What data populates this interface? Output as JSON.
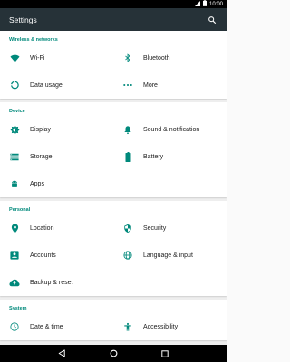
{
  "status_bar": {
    "time": "10:00",
    "signal_icon": "signal-icon",
    "battery_icon": "battery-icon"
  },
  "app_bar": {
    "title": "Settings",
    "search_icon": "search-icon"
  },
  "sections": {
    "wireless": {
      "header": "Wireless & networks",
      "items": [
        {
          "label": "Wi-Fi",
          "icon": "wifi-icon"
        },
        {
          "label": "Bluetooth",
          "icon": "bluetooth-icon"
        },
        {
          "label": "Data usage",
          "icon": "data-usage-icon"
        },
        {
          "label": "More",
          "icon": "more-icon"
        }
      ]
    },
    "device": {
      "header": "Device",
      "items": [
        {
          "label": "Display",
          "icon": "brightness-icon"
        },
        {
          "label": "Sound & notification",
          "icon": "bell-icon"
        },
        {
          "label": "Storage",
          "icon": "storage-icon"
        },
        {
          "label": "Battery",
          "icon": "battery-icon"
        },
        {
          "label": "Apps",
          "icon": "android-icon"
        }
      ]
    },
    "personal": {
      "header": "Personal",
      "items": [
        {
          "label": "Location",
          "icon": "location-pin-icon"
        },
        {
          "label": "Security",
          "icon": "shield-icon"
        },
        {
          "label": "Accounts",
          "icon": "account-icon"
        },
        {
          "label": "Language & input",
          "icon": "globe-icon"
        },
        {
          "label": "Backup & reset",
          "icon": "cloud-upload-icon"
        }
      ]
    },
    "system": {
      "header": "System",
      "items": [
        {
          "label": "Date & time",
          "icon": "clock-icon"
        },
        {
          "label": "Accessibility",
          "icon": "accessibility-icon"
        }
      ]
    }
  },
  "nav_bar": {
    "back_icon": "back-icon",
    "home_icon": "home-icon",
    "recents_icon": "recents-icon"
  },
  "colors": {
    "accent": "#00897b",
    "app_bar": "#263238",
    "icon": "#00897b",
    "text": "#212121"
  }
}
